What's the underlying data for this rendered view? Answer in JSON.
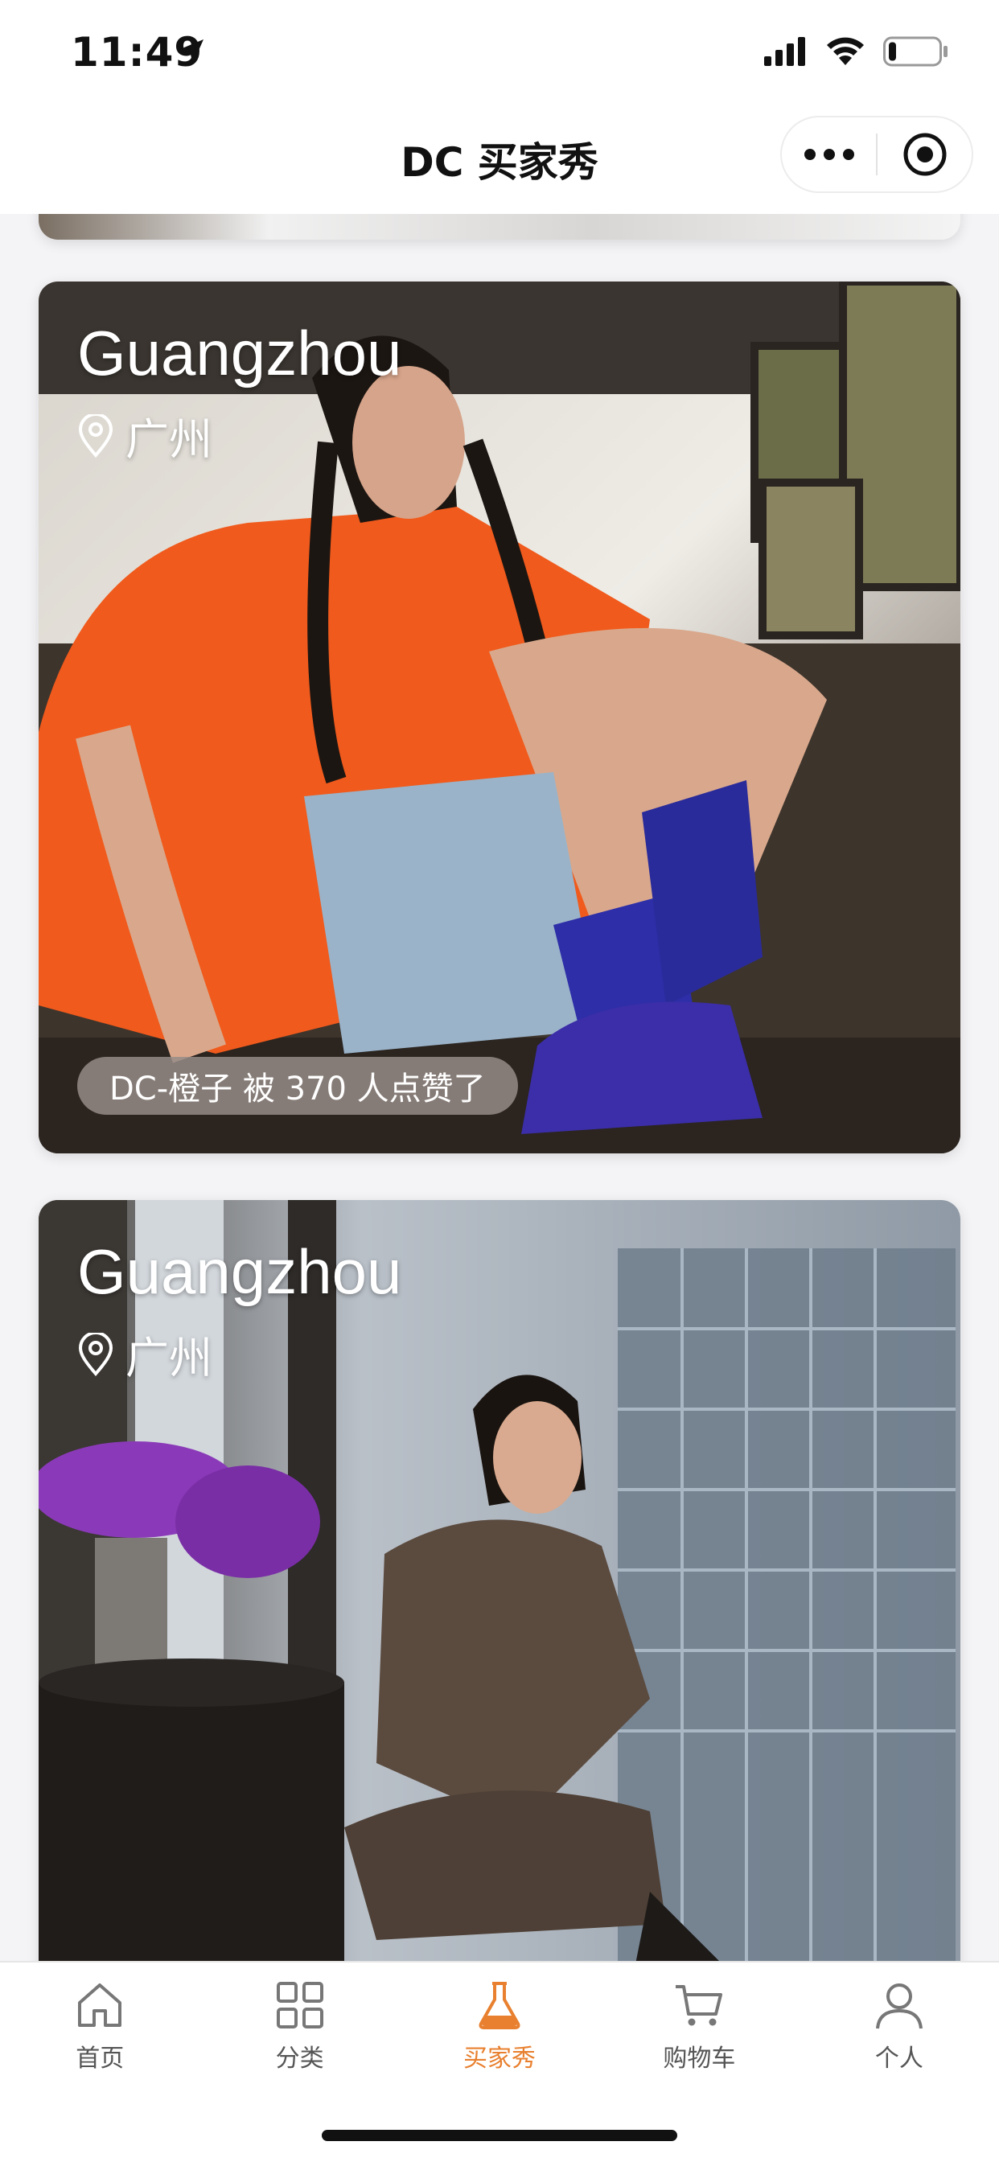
{
  "status_bar": {
    "time": "11:49",
    "location_icon": "location-arrow-icon",
    "signal_icon": "cellular-signal-icon",
    "wifi_icon": "wifi-icon",
    "battery_icon": "battery-icon",
    "battery_level": 0.15
  },
  "nav": {
    "title": "DC 买家秀",
    "more_icon": "more-dots-icon",
    "close_icon": "target-circle-icon"
  },
  "posts": [
    {
      "city_en": "Guangzhou",
      "location": "广州",
      "like_text": "DC-橙子 被 370 人点赞了"
    },
    {
      "city_en": "Guangzhou",
      "location": "广州"
    }
  ],
  "tabs": [
    {
      "label": "首页",
      "icon": "home-icon",
      "active": false
    },
    {
      "label": "分类",
      "icon": "grid-icon",
      "active": false
    },
    {
      "label": "买家秀",
      "icon": "flask-icon",
      "active": true
    },
    {
      "label": "购物车",
      "icon": "cart-icon",
      "active": false
    },
    {
      "label": "个人",
      "icon": "person-icon",
      "active": false
    }
  ],
  "colors": {
    "accent": "#e8802f",
    "tab_inactive": "#555555",
    "background": "#f4f4f6"
  }
}
